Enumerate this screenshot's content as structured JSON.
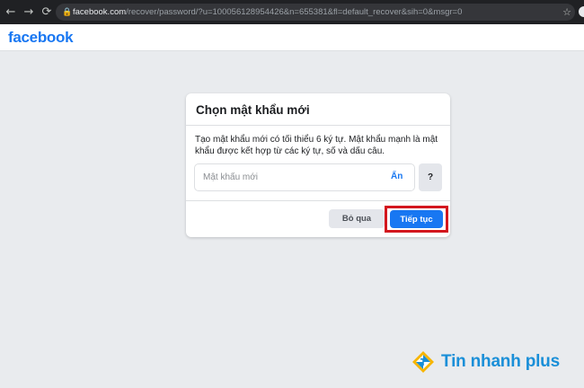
{
  "browser": {
    "back_icon": "←",
    "forward_icon": "→",
    "reload_icon": "⟳",
    "lock_icon": "🔒",
    "url_host": "facebook.com",
    "url_rest": "/recover/password/?u=100056128954426&n=655381&fl=default_recover&sih=0&msgr=0",
    "star_icon": "☆"
  },
  "header": {
    "logo_text": "facebook"
  },
  "dialog": {
    "title": "Chọn mật khẩu mới",
    "description": "Tạo mật khẩu mới có tối thiểu 6 ký tự. Mật khẩu mạnh là mật khẩu được kết hợp từ các ký tự, số và dấu câu.",
    "password_placeholder": "Mật khẩu mới",
    "password_value": "",
    "toggle_label": "Ẩn",
    "help_label": "?",
    "skip_label": "Bỏ qua",
    "continue_label": "Tiếp tục"
  },
  "watermark": {
    "text": "Tin nhanh plus"
  },
  "colors": {
    "facebook_blue": "#1877f2",
    "highlight_red": "#d3171e",
    "watermark_blue": "#1a8fd8"
  }
}
